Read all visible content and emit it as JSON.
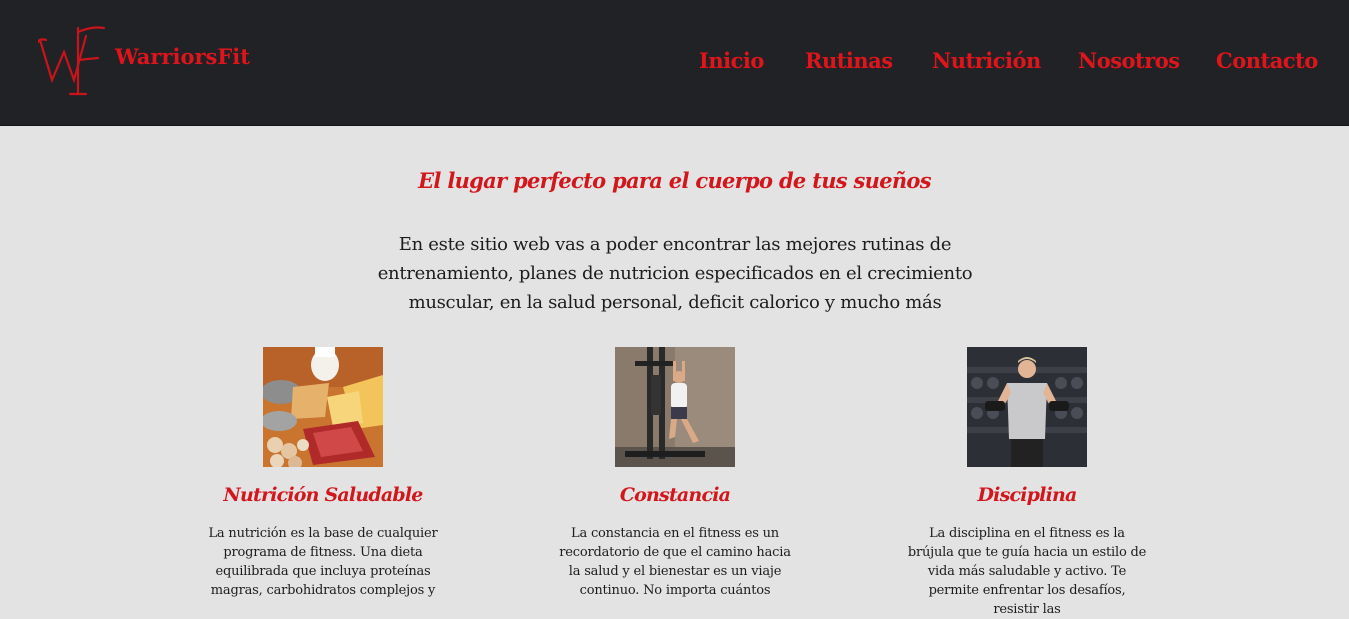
{
  "header": {
    "logo_icon": "wf-monogram-logo",
    "brand": "WarriorsFit",
    "nav": [
      "Inicio",
      "Rutinas",
      "Nutrición",
      "Nosotros",
      "Contacto"
    ]
  },
  "hero": {
    "tagline": "El lugar perfecto para el cuerpo de tus sueños",
    "intro": "En este sitio web vas a poder encontrar las mejores rutinas de entrenamiento, planes de nutricion especificados en el crecimiento muscular, en la salud personal, deficit calorico y mucho más"
  },
  "cards": [
    {
      "image": "healthy-food-photo",
      "title": "Nutrición Saludable",
      "text": "La nutrición es la base de cualquier programa de fitness. Una dieta equilibrada que incluya proteínas magras, carbohidratos complejos y"
    },
    {
      "image": "pull-up-workout-photo",
      "title": "Constancia",
      "text": "La constancia en el fitness es un recordatorio de que el camino hacia la salud y el bienestar es un viaje continuo. No importa cuántos"
    },
    {
      "image": "dumbbell-curl-athlete-photo",
      "title": "Disciplina",
      "text": "La disciplina en el fitness es la brújula que te guía hacia un estilo de vida más saludable y activo. Te permite enfrentar los desafíos, resistir las"
    }
  ],
  "colors": {
    "accent": "#e0141b",
    "header_bg": "#212226",
    "page_bg": "#e3e3e3"
  }
}
